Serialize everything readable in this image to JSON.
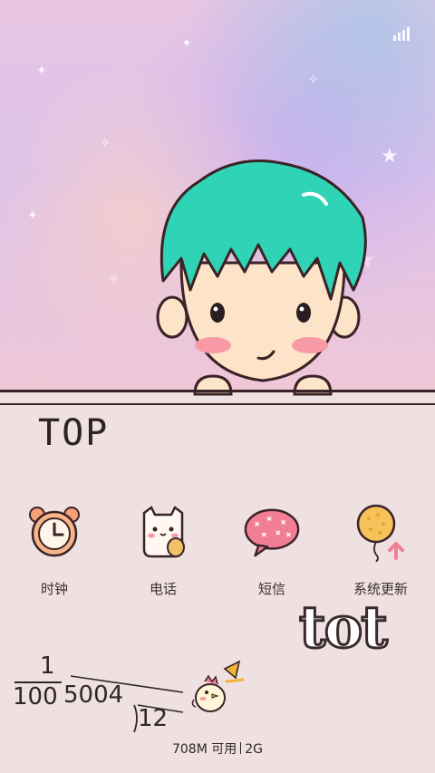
{
  "apps": [
    {
      "label": "时钟",
      "icon": "alarm-clock-icon"
    },
    {
      "label": "电话",
      "icon": "phone-cat-icon"
    },
    {
      "label": "短信",
      "icon": "speech-bubble-icon"
    },
    {
      "label": "系统更新",
      "icon": "balloon-update-icon"
    }
  ],
  "doodles": {
    "top_text": "TOP",
    "tot_text": "tot"
  },
  "clock": {
    "date_numerator": "1",
    "date_denominator": "100",
    "time_hours": "5004",
    "time_minutes": "12"
  },
  "memory": {
    "available": "708M 可用",
    "network": "2G"
  },
  "colors": {
    "hair": "#2fd4b6",
    "skin": "#fde3c8",
    "blush": "#f79aa6",
    "ink": "#2f2628"
  }
}
